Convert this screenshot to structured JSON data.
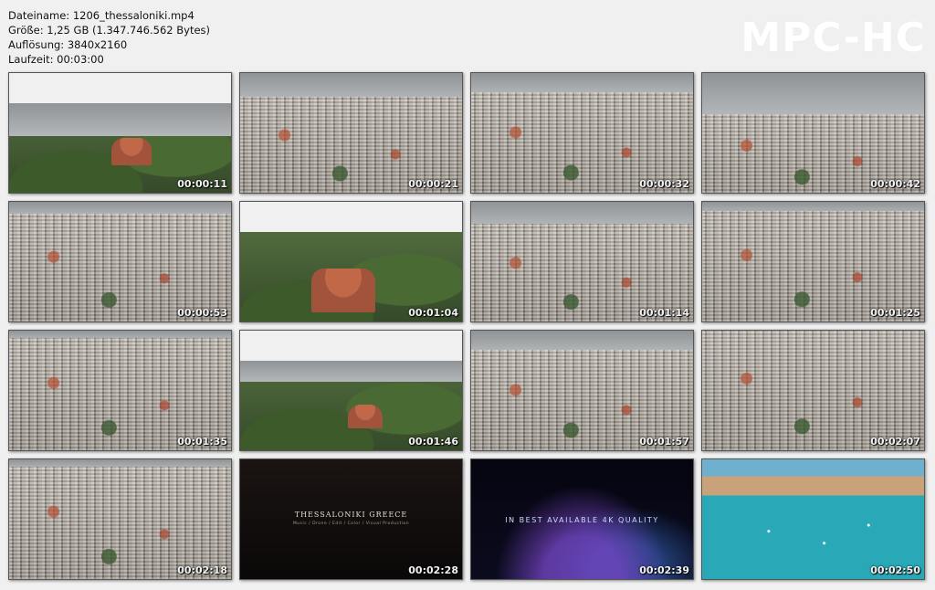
{
  "info": {
    "filename": "Dateiname: 1206_thessaloniki.mp4",
    "size": "Größe: 1,25 GB (1.347.746.562 Bytes)",
    "resolution": "Auflösung: 3840x2160",
    "duration": "Laufzeit: 00:03:00"
  },
  "logo": "MPC-HC",
  "thumbnails": [
    {
      "time": "00:00:11"
    },
    {
      "time": "00:00:21"
    },
    {
      "time": "00:00:32"
    },
    {
      "time": "00:00:42"
    },
    {
      "time": "00:00:53"
    },
    {
      "time": "00:01:04"
    },
    {
      "time": "00:01:14"
    },
    {
      "time": "00:01:25"
    },
    {
      "time": "00:01:35"
    },
    {
      "time": "00:01:46"
    },
    {
      "time": "00:01:57"
    },
    {
      "time": "00:02:07"
    },
    {
      "time": "00:02:18"
    },
    {
      "time": "00:02:28",
      "title": "THESSALONIKI GREECE",
      "subtitle": "Music / Drone / Edit / Color / Visual Production"
    },
    {
      "time": "00:02:39",
      "title": "IN BEST AVAILABLE 4K QUALITY"
    },
    {
      "time": "00:02:50"
    }
  ]
}
